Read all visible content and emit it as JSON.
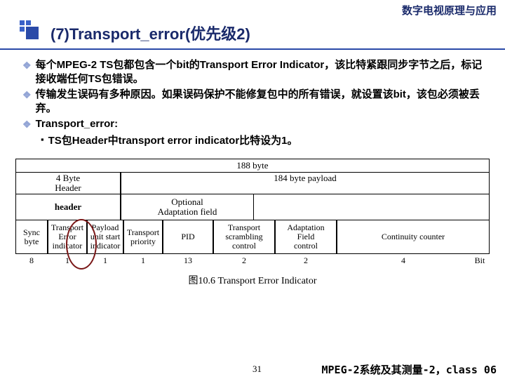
{
  "header": {
    "top_title": "数字电视原理与应用",
    "section": "(7)Transport_error(优先级2)"
  },
  "bullets": {
    "b1": "每个MPEG-2 TS包都包含一个bit的Transport Error Indicator，该比特紧跟同步字节之后，标记接收端任何TS包错误。",
    "b2": "传输发生误码有多种原因。如果误码保护不能修复包中的所有错误，就设置该bit，该包必须被丢弃。",
    "b3": "Transport_error:",
    "b3_1": "TS包Header中transport error indicator比特设为1。"
  },
  "figure": {
    "total": "188 byte",
    "header4": "4 Byte\nHeader",
    "payload": "184 byte payload",
    "header_label": "header",
    "oaf": "Optional\nAdaptation field",
    "fields": {
      "sync": "Sync\nbyte",
      "tei": "Transport\nError\nindicator",
      "pusi": "Payload\nunit start\nindicator",
      "tp": "Transport\npriority",
      "pid": "PID",
      "tsc": "Transport\nscrambling\ncontrol",
      "afc": "Adaptation\nField\ncontrol",
      "cc": "Continuity counter"
    },
    "bits": {
      "sync": "8",
      "tei": "1",
      "pusi": "1",
      "tp": "1",
      "pid": "13",
      "tsc": "2",
      "afc": "2",
      "cc": "4",
      "label": "Bit"
    },
    "caption": "图10.6 Transport Error Indicator"
  },
  "footer": {
    "page": "31",
    "right": "MPEG-2系统及其测量-2，class 06"
  }
}
